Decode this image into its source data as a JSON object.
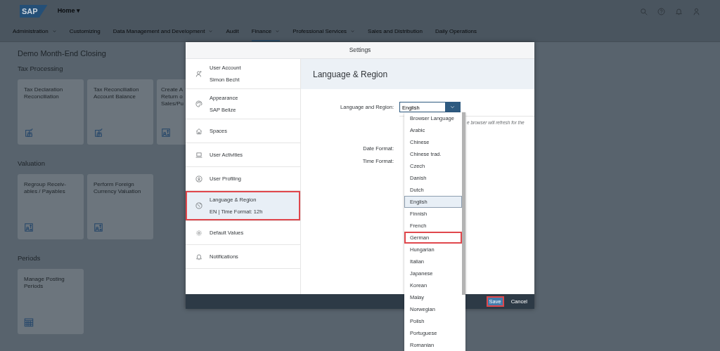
{
  "shell": {
    "logo": "SAP",
    "title": "Home ▾"
  },
  "nav_tabs": [
    {
      "label": "Administration",
      "dropdown": true,
      "selected": false
    },
    {
      "label": "Customizing",
      "dropdown": false,
      "selected": false
    },
    {
      "label": "Data Management and Development",
      "dropdown": true,
      "selected": false
    },
    {
      "label": "Audit",
      "dropdown": false,
      "selected": false
    },
    {
      "label": "Finance",
      "dropdown": true,
      "selected": true
    },
    {
      "label": "Professional Services",
      "dropdown": true,
      "selected": false
    },
    {
      "label": "Sales and Distribution",
      "dropdown": false,
      "selected": false
    },
    {
      "label": "Daily Operations",
      "dropdown": false,
      "selected": false
    }
  ],
  "page_title": "Demo Month-End Closing",
  "sections": [
    {
      "title": "Tax Processing",
      "tiles": [
        {
          "title": "Tax Declaration\nReconciliation",
          "cut": false
        },
        {
          "title": "Tax Reconciliation\nAccount Balance",
          "cut": false
        },
        {
          "title": "Create A\nReturn o\nSales/Pu",
          "cut": true
        }
      ]
    },
    {
      "title": "Valuation",
      "tiles": [
        {
          "title": "Regroup Receiv-\nables / Payables",
          "cut": false
        },
        {
          "title": "Perform Foreign\nCurrency Valuation",
          "cut": false
        }
      ]
    },
    {
      "title": "Periods",
      "tiles": [
        {
          "title": "Manage Posting\nPeriods",
          "cut": false
        }
      ]
    }
  ],
  "dialog": {
    "title": "Settings",
    "items": [
      {
        "label": "User Account",
        "sub": "Simon Becht",
        "selected": false,
        "highlighted": false
      },
      {
        "label": "Appearance",
        "sub": "SAP Belize",
        "selected": false,
        "highlighted": false
      },
      {
        "label": "Spaces",
        "selected": false,
        "highlighted": false
      },
      {
        "label": "User Activities",
        "selected": false,
        "highlighted": false
      },
      {
        "label": "User Profiling",
        "selected": false,
        "highlighted": false
      },
      {
        "label": "Language & Region",
        "sub": "EN | Time Format: 12h",
        "selected": true,
        "highlighted": true
      },
      {
        "label": "Default Values",
        "selected": false,
        "highlighted": false
      },
      {
        "label": "Notifications",
        "selected": false,
        "highlighted": false
      }
    ],
    "panel_title": "Language & Region",
    "language_label": "Language and Region:",
    "language_value": "English",
    "hint": "e browser will refresh for the",
    "date_label": "Date Format:",
    "time_label": "Time Format:",
    "options": [
      {
        "label": "Browser Language",
        "selected": false,
        "highlighted": false
      },
      {
        "label": "Arabic",
        "selected": false,
        "highlighted": false
      },
      {
        "label": "Chinese",
        "selected": false,
        "highlighted": false
      },
      {
        "label": "Chinese trad.",
        "selected": false,
        "highlighted": false
      },
      {
        "label": "Czech",
        "selected": false,
        "highlighted": false
      },
      {
        "label": "Danish",
        "selected": false,
        "highlighted": false
      },
      {
        "label": "Dutch",
        "selected": false,
        "highlighted": false
      },
      {
        "label": "English",
        "selected": true,
        "highlighted": false
      },
      {
        "label": "Finnish",
        "selected": false,
        "highlighted": false
      },
      {
        "label": "French",
        "selected": false,
        "highlighted": false
      },
      {
        "label": "German",
        "selected": false,
        "highlighted": true
      },
      {
        "label": "Hungarian",
        "selected": false,
        "highlighted": false
      },
      {
        "label": "Italian",
        "selected": false,
        "highlighted": false
      },
      {
        "label": "Japanese",
        "selected": false,
        "highlighted": false
      },
      {
        "label": "Korean",
        "selected": false,
        "highlighted": false
      },
      {
        "label": "Malay",
        "selected": false,
        "highlighted": false
      },
      {
        "label": "Norwegian",
        "selected": false,
        "highlighted": false
      },
      {
        "label": "Polish",
        "selected": false,
        "highlighted": false
      },
      {
        "label": "Portuguese",
        "selected": false,
        "highlighted": false
      },
      {
        "label": "Romanian",
        "selected": false,
        "highlighted": false
      }
    ],
    "buttons": [
      {
        "label": "Save",
        "kind": "primary",
        "highlighted": true
      },
      {
        "label": "Cancel",
        "kind": "plain",
        "highlighted": false
      }
    ]
  }
}
